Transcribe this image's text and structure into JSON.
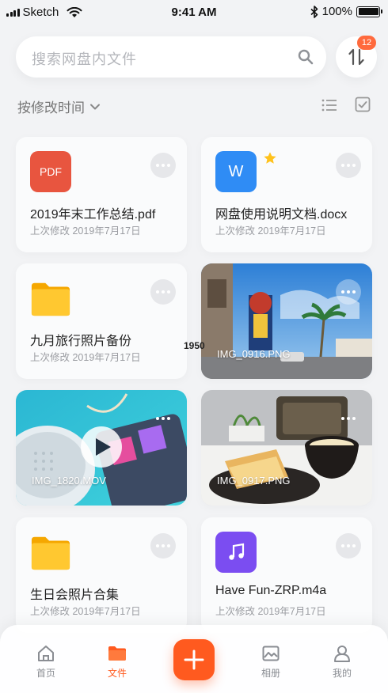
{
  "status_bar": {
    "carrier": "Sketch",
    "time": "9:41 AM",
    "battery": "100%"
  },
  "search": {
    "placeholder": "搜索网盘内文件"
  },
  "sort_badge": "12",
  "sort_label": "按修改时间",
  "files": [
    {
      "name": "2019年末工作总结.pdf",
      "modified": "上次修改 2019年7月17日",
      "icon_label": "PDF",
      "type": "pdf",
      "icon_color": "#e8553f"
    },
    {
      "name": "网盘使用说明文档.docx",
      "modified": "上次修改 2019年7月17日",
      "icon_label": "W",
      "type": "docx",
      "icon_color": "#2f8cf5",
      "starred": true
    },
    {
      "name": "九月旅行照片备份",
      "modified": "上次修改 2019年7月17日",
      "type": "folder",
      "icon_color": "#ffc21c"
    },
    {
      "name": "IMG_0916.PNG",
      "type": "image"
    },
    {
      "name": "IMG_1820.MOV",
      "type": "video"
    },
    {
      "name": "IMG_0917.PNG",
      "type": "image"
    },
    {
      "name": "生日会照片合集",
      "modified": "上次修改 2019年7月17日",
      "type": "folder",
      "icon_color": "#ffc21c"
    },
    {
      "name": "Have Fun-ZRP.m4a",
      "modified": "上次修改 2019年7月17日",
      "type": "audio",
      "icon_color": "#7b4df1"
    }
  ],
  "stray_text": "1950",
  "tabs": [
    {
      "label": "首页",
      "icon": "home-icon"
    },
    {
      "label": "文件",
      "icon": "folder-icon",
      "active": true
    },
    {
      "label": "相册",
      "icon": "image-icon"
    },
    {
      "label": "我的",
      "icon": "user-icon"
    }
  ],
  "colors": {
    "accent": "#ff5a1f",
    "badge": "#ff6a3d",
    "background": "#f2f3f5"
  }
}
